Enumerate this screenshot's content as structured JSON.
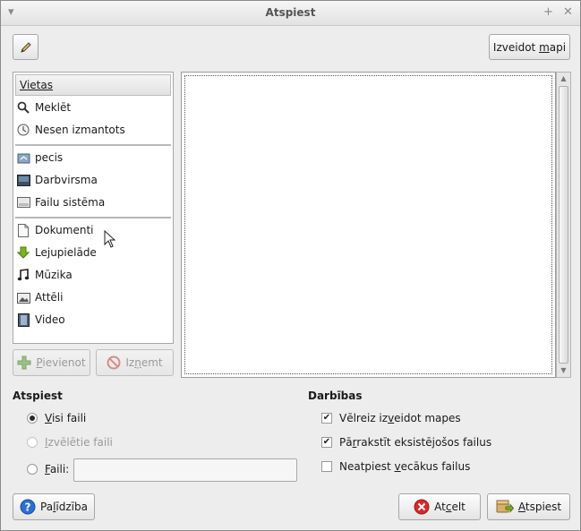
{
  "window": {
    "title": "Atspiest",
    "menu_icon": "chevron-down-icon",
    "maximize_icon": "plus-icon",
    "close_icon": "close-icon"
  },
  "toolbar": {
    "edit_location_icon": "pencil-icon",
    "create_folder_pre": "Izveidot ",
    "create_folder_mn": "m",
    "create_folder_post": "api"
  },
  "places": {
    "header": "Vietas",
    "items": [
      {
        "label": "Meklēt",
        "icon": "search-icon"
      },
      {
        "label": "Nesen izmantots",
        "icon": "recent-clock-icon"
      },
      {
        "label": "pecis",
        "icon": "home-folder-icon"
      },
      {
        "label": "Darbvirsma",
        "icon": "desktop-icon"
      },
      {
        "label": "Failu sistēma",
        "icon": "drive-icon"
      },
      {
        "label": "Dokumenti",
        "icon": "document-icon"
      },
      {
        "label": "Lejupielāde",
        "icon": "download-arrow-icon"
      },
      {
        "label": "Mūzika",
        "icon": "music-note-icon"
      },
      {
        "label": "Attēli",
        "icon": "pictures-icon"
      },
      {
        "label": "Video",
        "icon": "film-icon"
      }
    ],
    "add_button_mn": "P",
    "add_button_post": "ievienot",
    "remove_button_pre": "Iz",
    "remove_button_mn": "ņ",
    "remove_button_post": "emt"
  },
  "extract": {
    "title": "Atspiest",
    "options": [
      {
        "mn": "V",
        "rest": "isi faili",
        "selected": true,
        "disabled": false
      },
      {
        "mn": "I",
        "rest": "zvēlētie faili",
        "selected": false,
        "disabled": true
      },
      {
        "mn": "F",
        "rest": "aili:",
        "selected": false,
        "disabled": false
      }
    ],
    "files_value": ""
  },
  "actions": {
    "title": "Darbības",
    "options": [
      {
        "pre": "Vēlreiz iz",
        "mn": "v",
        "post": "eidot mapes",
        "checked": true
      },
      {
        "pre": "Pā",
        "mn": "r",
        "post": "rakstīt eksistējošos failus",
        "checked": true
      },
      {
        "pre": "Neatpiest ",
        "mn": "v",
        "post": "ecākus failus",
        "checked": false
      }
    ]
  },
  "footer": {
    "help_pre": "Pa",
    "help_mn": "l",
    "help_post": "īdzība",
    "cancel_pre": "At",
    "cancel_mn": "c",
    "cancel_post": "elt",
    "extract_mn": "A",
    "extract_post": "tspiest"
  },
  "colors": {
    "help_icon": "#2b6fd6",
    "cancel_icon": "#d62b2b",
    "download_arrow": "#7ab51d",
    "add_icon": "#9cc08a",
    "remove_icon": "#d88a8a"
  }
}
